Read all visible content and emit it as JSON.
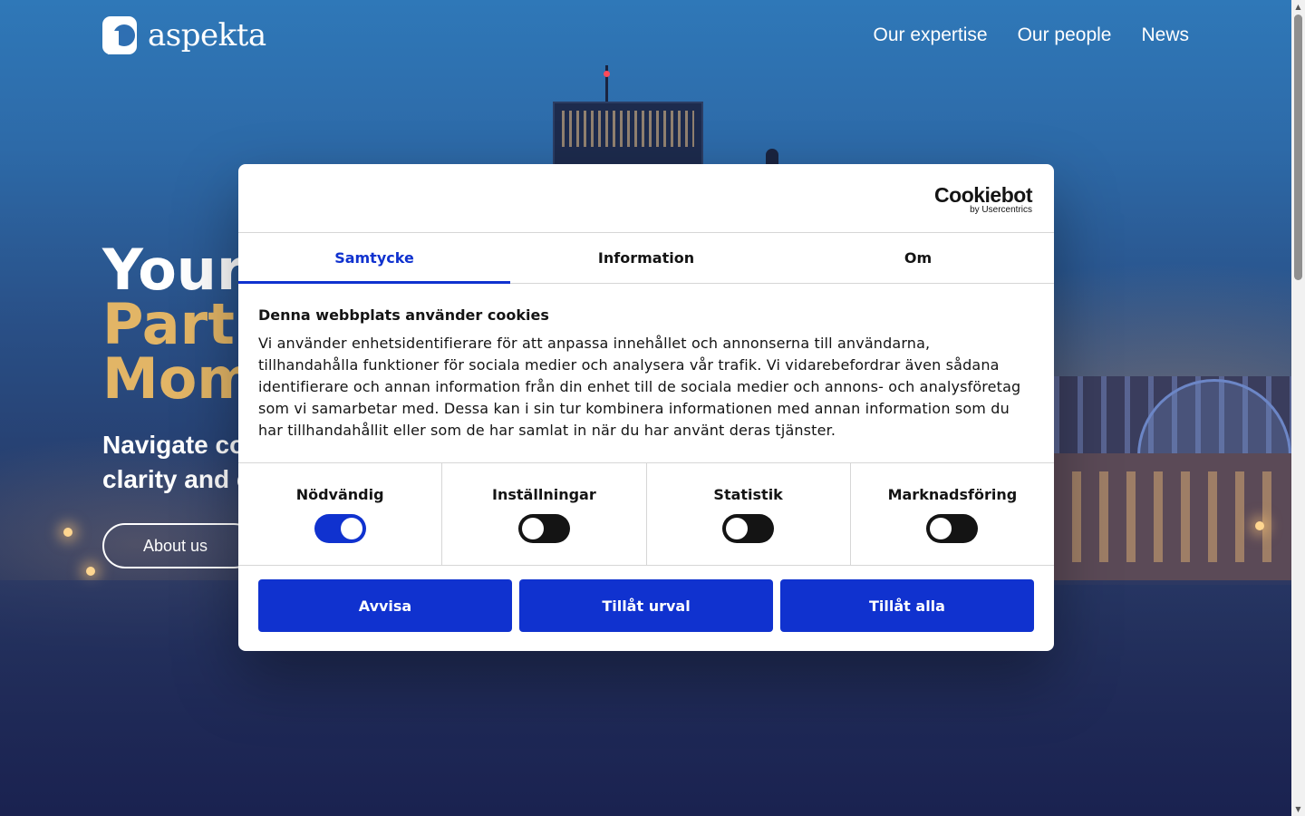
{
  "brand": {
    "name": "aspekta"
  },
  "nav": {
    "items": [
      "Our expertise",
      "Our people",
      "News"
    ]
  },
  "hero": {
    "line1": "Your",
    "line2": "Partn",
    "line3": "Mom",
    "sub1": "Navigate co",
    "sub2": "clarity and c",
    "button": "About us"
  },
  "cookie": {
    "logo_name": "Cookiebot",
    "logo_by": "by Usercentrics",
    "tabs": [
      "Samtycke",
      "Information",
      "Om"
    ],
    "active_tab": "Samtycke",
    "title": "Denna webbplats använder cookies",
    "text": "Vi använder enhetsidentifierare för att anpassa innehållet och annonserna till användarna, tillhandahålla funktioner för sociala medier och analysera vår trafik. Vi vidarebefordrar även sådana identifierare och annan information från din enhet till de sociala medier och annons- och analysföretag som vi samarbetar med. Dessa kan i sin tur kombinera informationen med annan information som du har tillhandahållit eller som de har samlat in när du har använt deras tjänster.",
    "toggles": [
      {
        "label": "Nödvändig",
        "on": true
      },
      {
        "label": "Inställningar",
        "on": false
      },
      {
        "label": "Statistik",
        "on": false
      },
      {
        "label": "Marknadsföring",
        "on": false
      }
    ],
    "buttons": {
      "reject": "Avvisa",
      "selection": "Tillåt urval",
      "all": "Tillåt alla"
    }
  },
  "colors": {
    "accent": "#1032cf",
    "gold": "#e2b566"
  }
}
